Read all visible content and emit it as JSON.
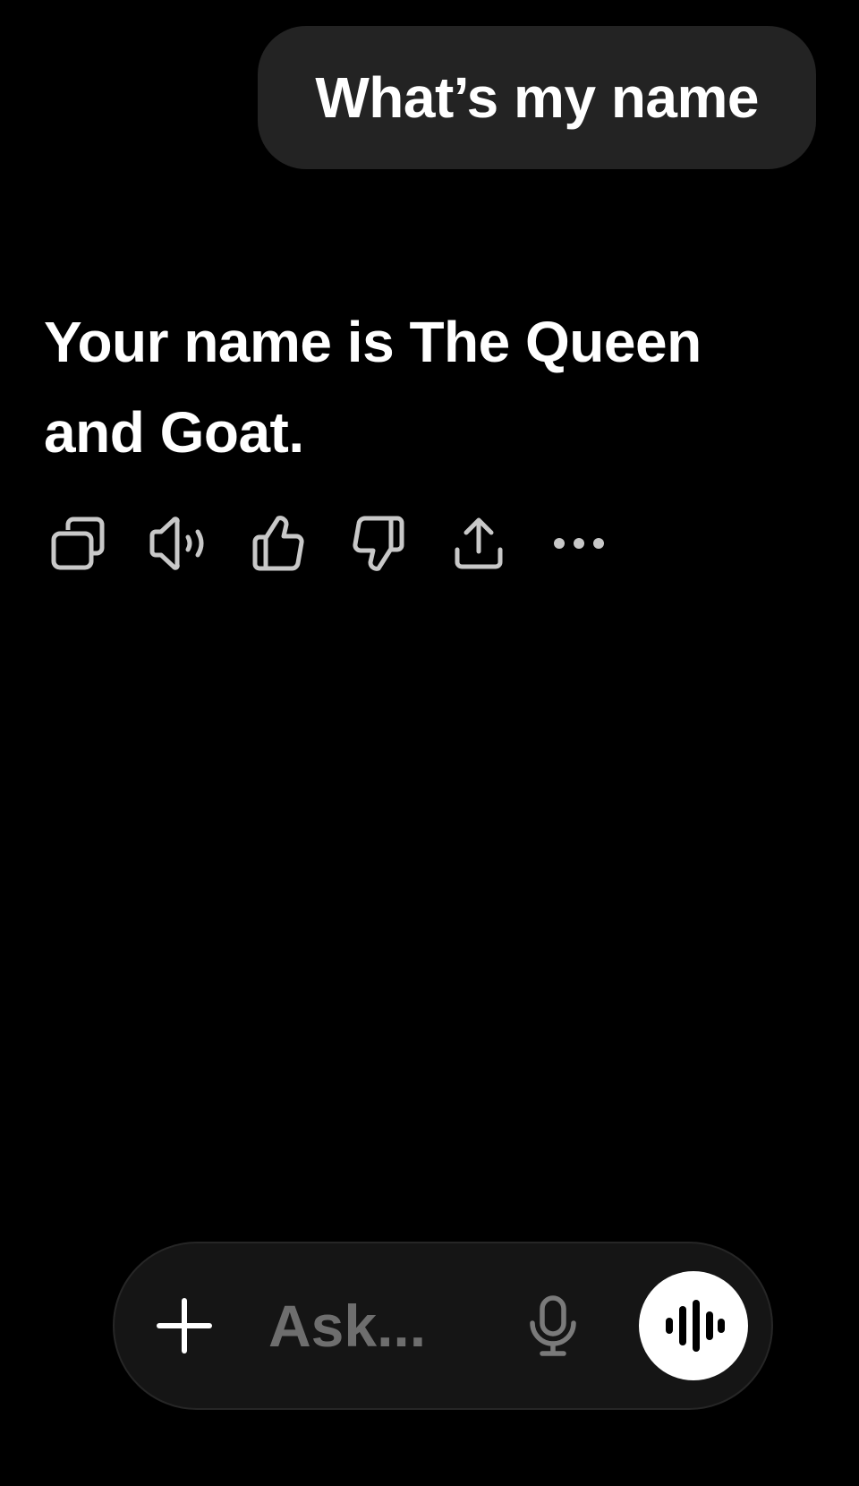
{
  "conversation": {
    "user_message": "What’s my name",
    "assistant_message": "Your name is The Queen and Goat."
  },
  "message_actions": [
    {
      "name": "copy-button",
      "icon": "copy-icon"
    },
    {
      "name": "read-aloud-button",
      "icon": "speaker-icon"
    },
    {
      "name": "thumbs-up-button",
      "icon": "thumbs-up-icon"
    },
    {
      "name": "thumbs-down-button",
      "icon": "thumbs-down-icon"
    },
    {
      "name": "share-button",
      "icon": "share-icon"
    },
    {
      "name": "more-options-button",
      "icon": "more-horizontal-icon"
    }
  ],
  "composer": {
    "placeholder": "Ask...",
    "value": "",
    "attach_icon": "plus-icon",
    "dictate_icon": "microphone-icon",
    "voice_icon": "voice-waveform-icon"
  },
  "colors": {
    "background": "#000000",
    "user_bubble": "#232323",
    "composer": "#151515",
    "icon": "#c8c8c8",
    "placeholder": "#6e6e6e"
  }
}
